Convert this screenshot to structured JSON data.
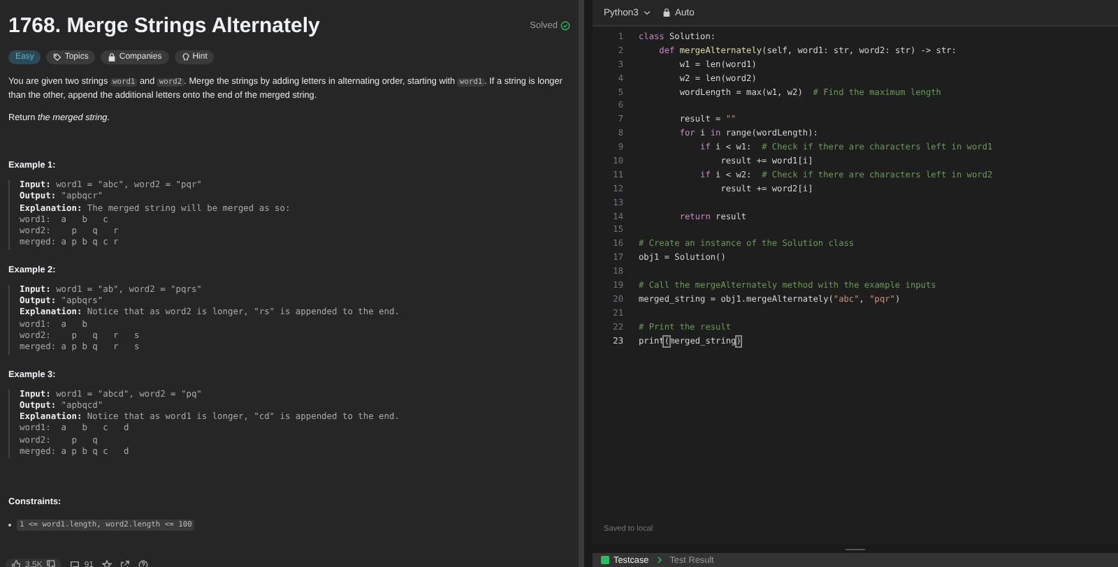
{
  "problem": {
    "title": "1768. Merge Strings Alternately",
    "status": "Solved",
    "tags": [
      {
        "kind": "difficulty",
        "label": "Easy"
      },
      {
        "kind": "topics",
        "label": "Topics"
      },
      {
        "kind": "companies",
        "label": "Companies"
      },
      {
        "kind": "hint",
        "label": "Hint"
      }
    ],
    "description": [
      {
        "kind": "text",
        "text": "You are given two strings "
      },
      {
        "kind": "code",
        "text": "word1"
      },
      {
        "kind": "text",
        "text": " and "
      },
      {
        "kind": "code",
        "text": "word2"
      },
      {
        "kind": "text",
        "text": ". Merge the strings by adding letters in alternating order, starting with "
      },
      {
        "kind": "code",
        "text": "word1"
      },
      {
        "kind": "text",
        "text": ". If a string is longer than the other, append the additional letters onto the end of the merged string."
      }
    ],
    "return_text": "Return *the merged string.*",
    "examples": [
      {
        "title": "Example 1:",
        "lines": [
          "**Input:** word1 = \"abc\", word2 = \"pqr\"",
          "**Output:** \"apbqcr\"",
          "**Explanation:** The merged string will be merged as so:",
          "word1:  a   b   c",
          "word2:    p   q   r",
          "merged: a p b q c r"
        ]
      },
      {
        "title": "Example 2:",
        "lines": [
          "**Input:** word1 = \"ab\", word2 = \"pqrs\"",
          "**Output:** \"apbqrs\"",
          "**Explanation:** Notice that as word2 is longer, \"rs\" is appended to the end.",
          "word1:  a   b",
          "word2:    p   q   r   s",
          "merged: a p b q   r   s"
        ]
      },
      {
        "title": "Example 3:",
        "lines": [
          "**Input:** word1 = \"abcd\", word2 = \"pq\"",
          "**Output:** \"apbqcd\"",
          "**Explanation:** Notice that as word1 is longer, \"cd\" is appended to the end.",
          "word1:  a   b   c   d",
          "word2:    p   q",
          "merged: a p b q c   d"
        ]
      }
    ],
    "constraints_title": "Constraints:",
    "constraints": [
      "1 <= word1.length, word2.length <= 100"
    ],
    "footer": {
      "likes": "3.5K",
      "comments": "91"
    }
  },
  "editor": {
    "language": "Python3",
    "mode": "Auto",
    "lines": [
      {
        "num": "1",
        "current": false,
        "tokens": [
          {
            "kind": "kw",
            "text": "class"
          },
          {
            "kind": "pl",
            "text": " Solution:"
          }
        ]
      },
      {
        "num": "2",
        "current": false,
        "tokens": [
          {
            "kind": "kw",
            "text": "    def"
          },
          {
            "kind": "fn",
            "text": " mergeAlternately"
          },
          {
            "kind": "pl",
            "text": "(self, word1: str, word2: str) -> str:"
          }
        ]
      },
      {
        "num": "3",
        "current": false,
        "tokens": [
          {
            "kind": "pl",
            "text": "        w1 = len(word1)"
          }
        ]
      },
      {
        "num": "4",
        "current": false,
        "tokens": [
          {
            "kind": "pl",
            "text": "        w2 = len(word2)"
          }
        ]
      },
      {
        "num": "5",
        "current": false,
        "tokens": [
          {
            "kind": "pl",
            "text": "        wordLength = max(w1, w2)  "
          },
          {
            "kind": "cm",
            "text": "# Find the maximum length"
          }
        ]
      },
      {
        "num": "6",
        "current": false
      },
      {
        "num": "7",
        "current": false,
        "tokens": [
          {
            "kind": "pl",
            "text": "        result = "
          },
          {
            "kind": "str",
            "text": "\"\""
          }
        ]
      },
      {
        "num": "8",
        "current": false,
        "tokens": [
          {
            "kind": "kw",
            "text": "        for"
          },
          {
            "kind": "pl",
            "text": " i "
          },
          {
            "kind": "kw",
            "text": "in"
          },
          {
            "kind": "pl",
            "text": " range(wordLength):"
          }
        ]
      },
      {
        "num": "9",
        "current": false,
        "tokens": [
          {
            "kind": "kw",
            "text": "            if"
          },
          {
            "kind": "pl",
            "text": " i < w1:  "
          },
          {
            "kind": "cm",
            "text": "# Check if there are characters left in word1"
          }
        ]
      },
      {
        "num": "10",
        "current": false,
        "tokens": [
          {
            "kind": "pl",
            "text": "                result += word1[i]"
          }
        ]
      },
      {
        "num": "11",
        "current": false,
        "tokens": [
          {
            "kind": "kw",
            "text": "            if"
          },
          {
            "kind": "pl",
            "text": " i < w2:  "
          },
          {
            "kind": "cm",
            "text": "# Check if there are characters left in word2"
          }
        ]
      },
      {
        "num": "12",
        "current": false,
        "tokens": [
          {
            "kind": "pl",
            "text": "                result += word2[i]"
          }
        ]
      },
      {
        "num": "13",
        "current": false
      },
      {
        "num": "14",
        "current": false,
        "tokens": [
          {
            "kind": "kw",
            "text": "        return"
          },
          {
            "kind": "pl",
            "text": " result"
          }
        ]
      },
      {
        "num": "15",
        "current": false
      },
      {
        "num": "16",
        "current": false,
        "tokens": [
          {
            "kind": "cm",
            "text": "# Create an instance of the Solution class"
          }
        ]
      },
      {
        "num": "17",
        "current": false,
        "tokens": [
          {
            "kind": "pl",
            "text": "obj1 = Solution()"
          }
        ]
      },
      {
        "num": "18",
        "current": false
      },
      {
        "num": "19",
        "current": false,
        "tokens": [
          {
            "kind": "cm",
            "text": "# Call the mergeAlternately method with the example inputs"
          }
        ]
      },
      {
        "num": "20",
        "current": false,
        "tokens": [
          {
            "kind": "pl",
            "text": "merged_string = obj1.mergeAlternately("
          },
          {
            "kind": "str",
            "text": "\"abc\""
          },
          {
            "kind": "pl",
            "text": ", "
          },
          {
            "kind": "str",
            "text": "\"pqr\""
          },
          {
            "kind": "pl",
            "text": ")"
          }
        ]
      },
      {
        "num": "21",
        "current": false
      },
      {
        "num": "22",
        "current": false,
        "tokens": [
          {
            "kind": "cm",
            "text": "# Print the result"
          }
        ]
      },
      {
        "num": "23",
        "current": true,
        "tokens": [
          {
            "kind": "pl",
            "text": "print"
          },
          {
            "kind": "br",
            "text": "("
          },
          {
            "kind": "pl",
            "text": "merged_string"
          },
          {
            "kind": "br",
            "text": ")"
          }
        ]
      }
    ],
    "save_status": "Saved to local"
  },
  "bottom_tabs": [
    {
      "kind": "testcase",
      "label": "Testcase",
      "selected": true
    },
    {
      "kind": "result",
      "label": "Test Result",
      "selected": false
    }
  ]
}
